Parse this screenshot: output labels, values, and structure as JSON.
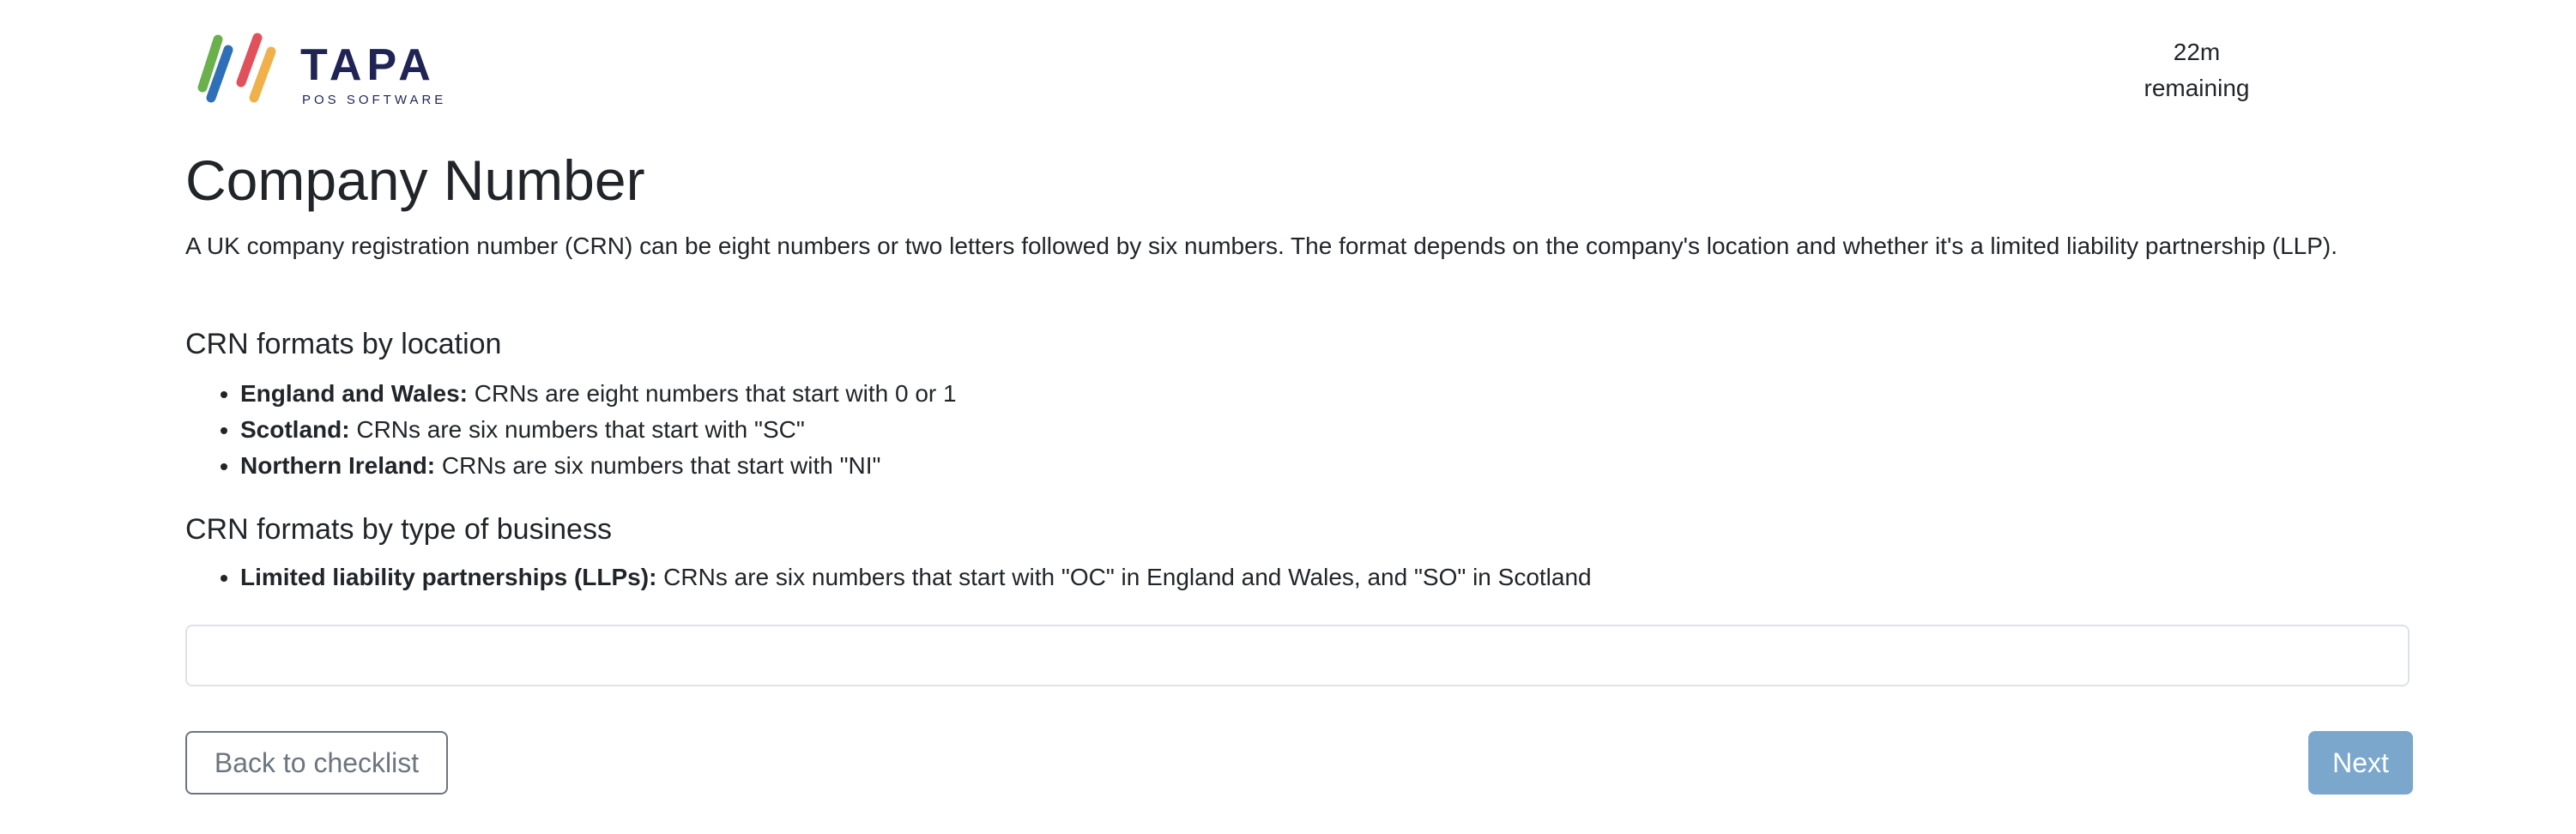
{
  "brand": {
    "name": "TAPA",
    "tagline": "POS SOFTWARE",
    "colors": [
      "#6ab04c",
      "#2f6fb7",
      "#e0515c",
      "#f0b04a"
    ]
  },
  "timer": {
    "value": "22m",
    "label": "remaining"
  },
  "page": {
    "title": "Company Number",
    "intro": "A UK company registration number (CRN) can be eight numbers or two letters followed by six numbers. The format depends on the company's location and whether it's a limited liability partnership (LLP)."
  },
  "sections": {
    "location": {
      "heading": "CRN formats by location",
      "items": [
        {
          "label": "England and Wales:",
          "text": " CRNs are eight numbers that start with 0 or 1"
        },
        {
          "label": "Scotland:",
          "text": " CRNs are six numbers that start with \"SC\""
        },
        {
          "label": "Northern Ireland:",
          "text": " CRNs are six numbers that start with \"NI\""
        }
      ]
    },
    "business": {
      "heading": "CRN formats by type of business",
      "items": [
        {
          "label": "Limited liability partnerships (LLPs):",
          "text": " CRNs are six numbers that start with \"OC\" in England and Wales, and \"SO\" in Scotland"
        }
      ]
    }
  },
  "form": {
    "crn_value": "",
    "crn_placeholder": ""
  },
  "actions": {
    "back_label": "Back to checklist",
    "next_label": "Next"
  }
}
